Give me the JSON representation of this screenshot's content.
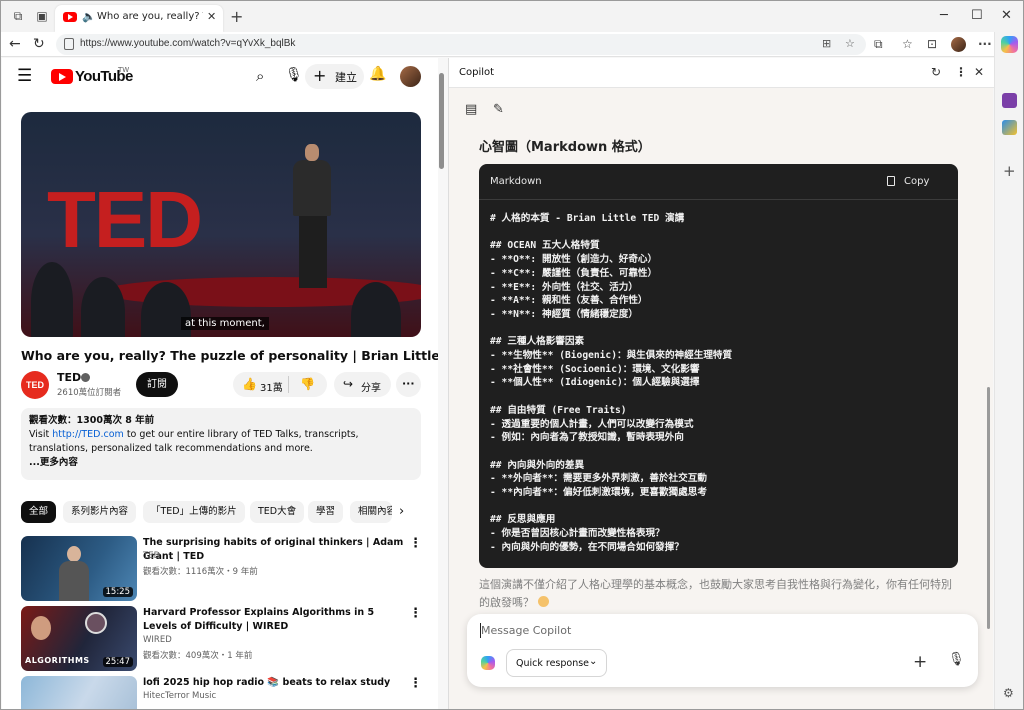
{
  "browser": {
    "tab_title": "Who are you, really? The puzzle of personality | Brian Little | TED",
    "url": "https://www.youtube.com/watch?v=qYvXk_bqlBk",
    "icons": [
      "workspaces-icon",
      "tab-actions-icon",
      "youtube-favicon",
      "speaker-icon",
      "close-tab-icon",
      "new-tab-icon",
      "minimize-icon",
      "maximize-icon",
      "close-window-icon",
      "back-icon",
      "refresh-icon",
      "lock-icon",
      "split-screen-icon",
      "favorite-icon",
      "extensions-icon",
      "favorites-icon",
      "screenshot-icon",
      "profile-avatar",
      "more-icon",
      "copilot-icon"
    ]
  },
  "youtube": {
    "logo_text": "YouTube",
    "region": "TW",
    "create_label": "建立",
    "player_caption": "at this moment,",
    "video_title": "Who are you, really? The puzzle of personality | Brian Little | TED",
    "channel": {
      "name": "TED",
      "subs": "2610萬位訂閱者",
      "avatar_text": "TED"
    },
    "subscribe_label": "訂閱",
    "likes": "31萬",
    "share_label": "分享",
    "description": {
      "line1": "觀看次數：1300萬次  8 年前",
      "visit": "Visit ",
      "link": "http://TED.com",
      "rest": " to get our entire library of TED Talks, transcripts, translations, personalized talk recommendations and more.",
      "more": "...更多內容"
    },
    "chips": [
      "全部",
      "系列影片內容",
      "「TED」上傳的影片",
      "TED大會",
      "學習",
      "相關內容"
    ],
    "related": [
      {
        "title": "The surprising habits of original thinkers | Adam Grant | TED",
        "channel": "TED",
        "meta": "觀看次數：1116萬次・9 年前",
        "duration": "15:25"
      },
      {
        "title": "Harvard Professor Explains Algorithms in 5 Levels of Difficulty | WIRED",
        "channel": "WIRED",
        "meta": "觀看次數：409萬次・1 年前",
        "duration": "25:47",
        "thumb_text": "ALGORITHMS"
      },
      {
        "title": "lofi 2025 hip hop radio 📚 beats to relax study",
        "channel": "HitecTerror Music",
        "meta": "",
        "duration": ""
      }
    ]
  },
  "copilot": {
    "header_title": "Copilot",
    "mindmap_title": "心智圖（Markdown 格式）",
    "code_lang": "Markdown",
    "copy_label": "Copy",
    "code_lines": [
      "# 人格的本質 - Brian Little TED 演講",
      "",
      "## OCEAN 五大人格特質",
      "- **O**: 開放性（創造力、好奇心）",
      "- **C**: 嚴謹性（負責任、可靠性）",
      "- **E**: 外向性（社交、活力）",
      "- **A**: 親和性（友善、合作性）",
      "- **N**: 神經質（情緒穩定度）",
      "",
      "## 三種人格影響因素",
      "- **生物性** (Biogenic)：與生俱來的神經生理特質",
      "- **社會性** (Socioenic)：環境、文化影響",
      "- **個人性** (Idiogenic)：個人經驗與選擇",
      "",
      "## 自由特質 (Free Traits)",
      "- 透過重要的個人計畫，人們可以改變行為模式",
      "- 例如：內向者為了教授知識，暫時表現外向",
      "",
      "## 內向與外向的差異",
      "- **外向者**：需要更多外界刺激，善於社交互動",
      "- **內向者**：偏好低刺激環境，更喜歡獨處思考",
      "",
      "## 反思與應用",
      "- 你是否曾因核心計畫而改變性格表現？",
      "- 內向與外向的優勢，在不同場合如何發揮？"
    ],
    "after_text": "這個演講不僅介紹了人格心理學的基本概念，也鼓勵大家思考自我性格與行為變化，你有任何特別的啟發嗎？",
    "input_placeholder": "Message Copilot",
    "mode_label": "Quick response"
  }
}
